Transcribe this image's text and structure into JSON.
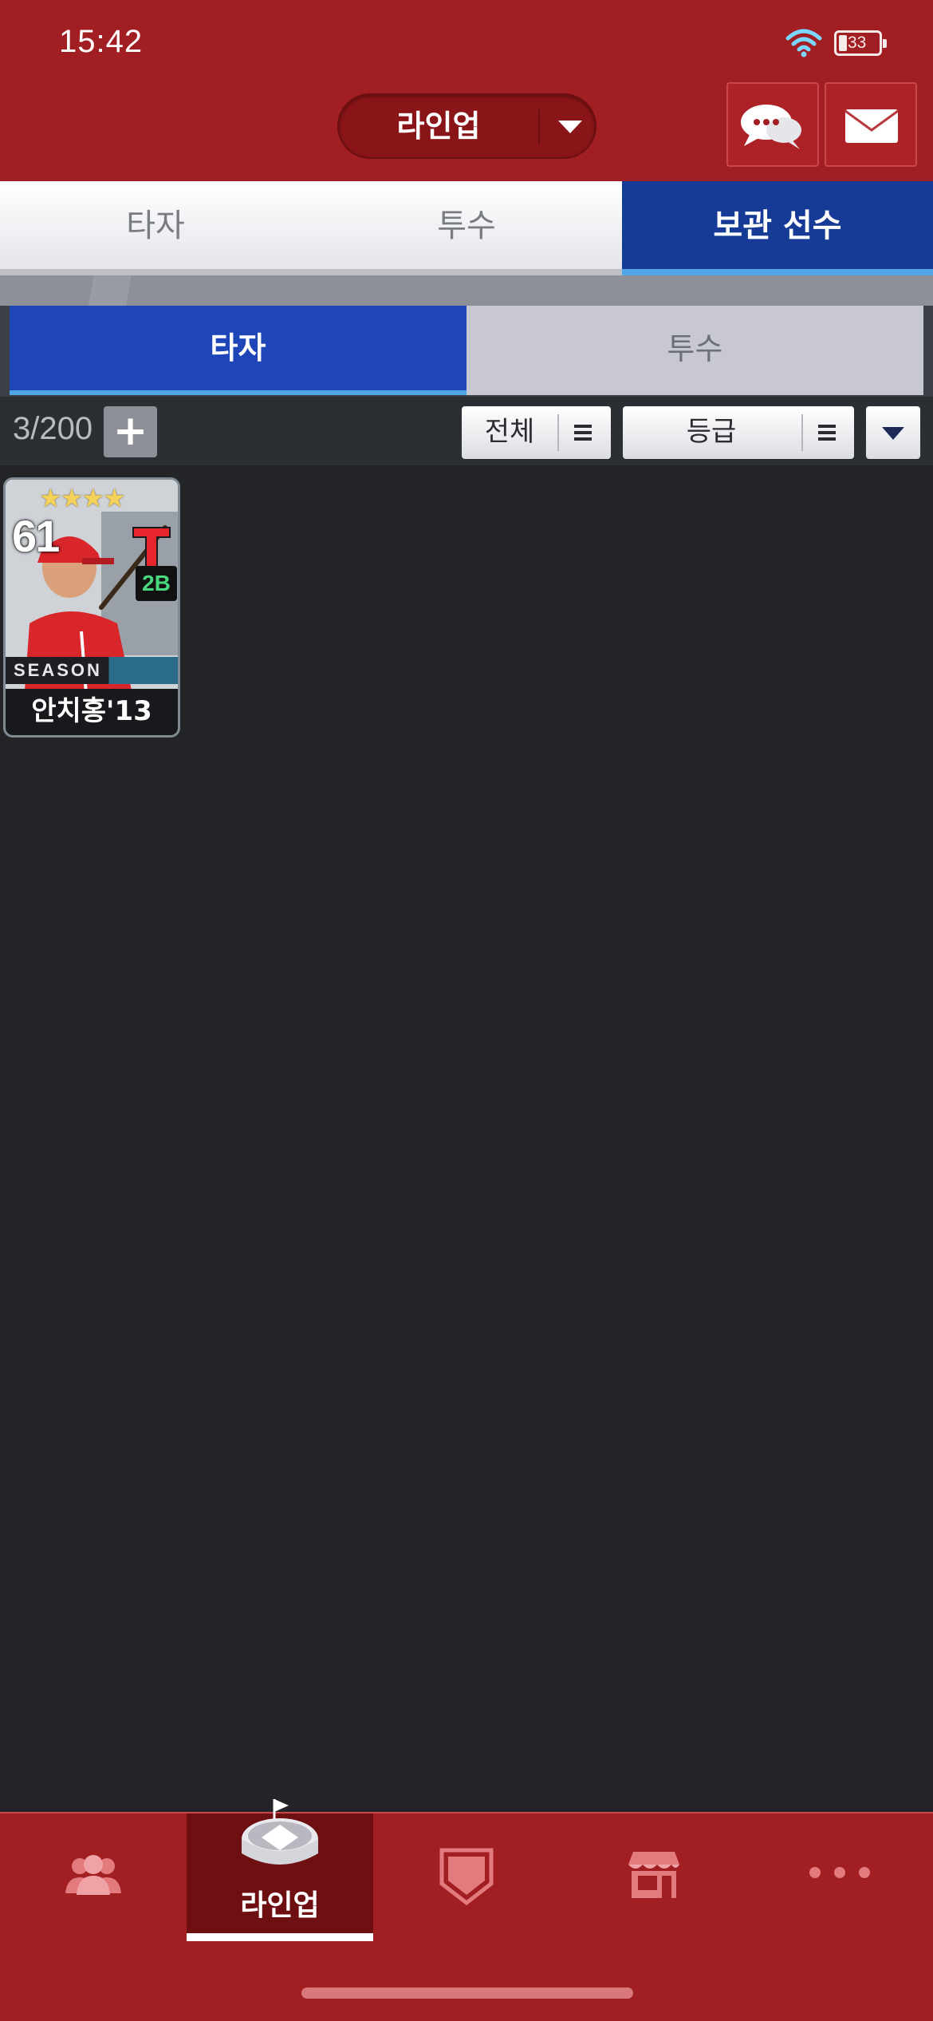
{
  "status_bar": {
    "time": "15:42",
    "battery_level": "33",
    "icons": [
      "wifi-icon",
      "battery-icon"
    ]
  },
  "header": {
    "mode_label": "라인업",
    "buttons": [
      {
        "name": "chat-button",
        "icon": "chat-bubbles-icon"
      },
      {
        "name": "mail-button",
        "icon": "envelope-icon"
      }
    ]
  },
  "top_tabs": [
    {
      "label": "타자",
      "active": false
    },
    {
      "label": "투수",
      "active": false
    },
    {
      "label": "보관 선수",
      "active": true
    }
  ],
  "sub_tabs": [
    {
      "label": "타자",
      "active": true
    },
    {
      "label": "투수",
      "active": false
    }
  ],
  "toolbar": {
    "count": "3/200",
    "add_label": "+",
    "filter_all_label": "전체",
    "filter_grade_label": "등급",
    "sort_icon": "caret-down-icon"
  },
  "players": [
    {
      "overall": "61",
      "stars": "★★★★",
      "position": "2B",
      "card_type": "SEASON",
      "name": "안치홍'13"
    }
  ],
  "bottom_nav": [
    {
      "icon": "team-icon",
      "label": "",
      "active": false
    },
    {
      "icon": "stadium-icon",
      "label": "라인업",
      "active": true
    },
    {
      "icon": "home-plate-icon",
      "label": "",
      "active": false
    },
    {
      "icon": "shop-icon",
      "label": "",
      "active": false
    },
    {
      "icon": "more-icon",
      "label": "",
      "active": false
    }
  ],
  "colors": {
    "header_red": "#a11e22",
    "active_tab_blue": "#163b97",
    "sub_tab_blue": "#1e46b8",
    "accent_cyan": "#4fa5e6",
    "background_dark": "#222428"
  }
}
